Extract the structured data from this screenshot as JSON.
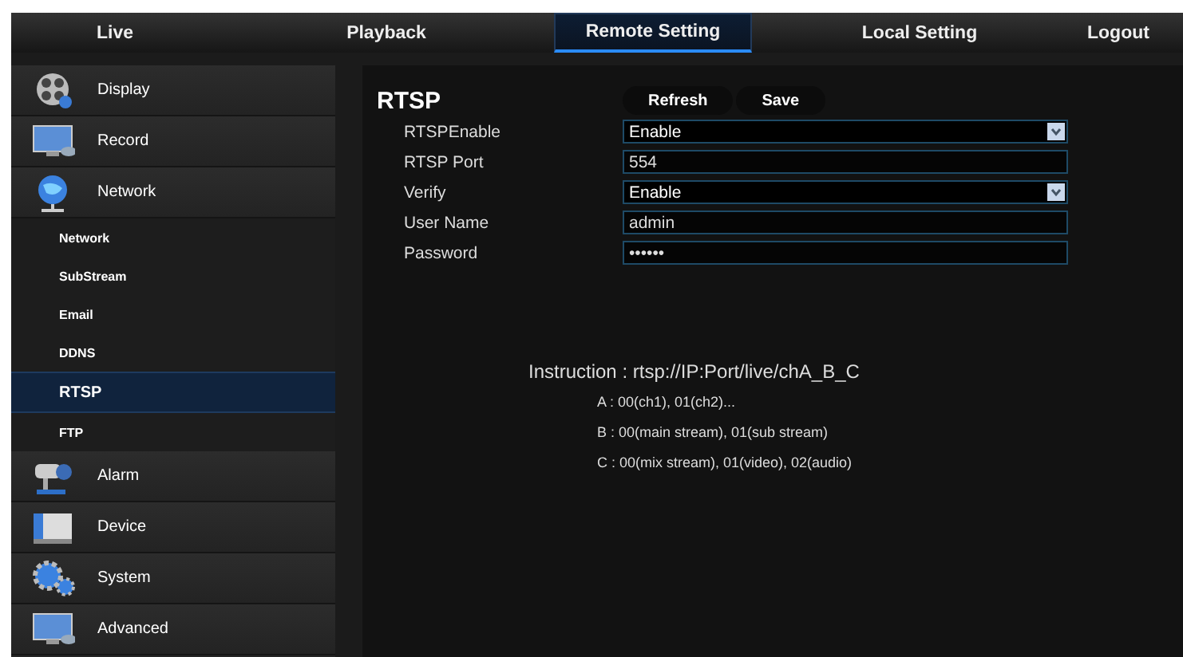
{
  "nav_tabs": [
    {
      "label": "Live",
      "selected": false
    },
    {
      "label": "Playback",
      "selected": false
    },
    {
      "label": "Remote Setting",
      "selected": true
    },
    {
      "label": "Local Setting",
      "selected": false
    },
    {
      "label": "Logout",
      "selected": false
    }
  ],
  "sidebar": {
    "items": [
      {
        "label": "Display",
        "selected": false
      },
      {
        "label": "Record",
        "selected": false
      },
      {
        "label": "Network",
        "selected": false,
        "children": [
          {
            "label": "Network",
            "selected": false
          },
          {
            "label": "SubStream",
            "selected": false
          },
          {
            "label": "Email",
            "selected": false
          },
          {
            "label": "DDNS",
            "selected": false
          },
          {
            "label": "RTSP",
            "selected": true
          },
          {
            "label": "FTP",
            "selected": false
          }
        ]
      },
      {
        "label": "Alarm",
        "selected": false
      },
      {
        "label": "Device",
        "selected": false
      },
      {
        "label": "System",
        "selected": false
      },
      {
        "label": "Advanced",
        "selected": false
      }
    ]
  },
  "panel": {
    "title": "RTSP",
    "buttons": [
      "Refresh",
      "Save"
    ],
    "fields": [
      {
        "label": "RTSPEnable",
        "kind": "dropdown",
        "value": "Enable"
      },
      {
        "label": "RTSP Port",
        "kind": "text",
        "value": "554"
      },
      {
        "label": "Verify",
        "kind": "dropdown",
        "value": "Enable"
      },
      {
        "label": "User Name",
        "kind": "text",
        "value": "admin"
      },
      {
        "label": "Password",
        "kind": "password",
        "value": "••••••"
      }
    ],
    "instruction": "Instruction : rtsp://IP:Port/live/chA_B_C",
    "notes": [
      "A : 00(ch1), 01(ch2)...",
      "B : 00(main stream), 01(sub stream)",
      "C : 00(mix stream), 01(video), 02(audio)"
    ]
  }
}
